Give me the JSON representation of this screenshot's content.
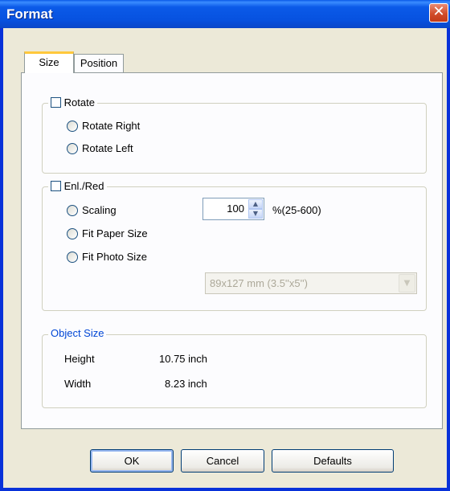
{
  "window": {
    "title": "Format",
    "close_glyph": "✕"
  },
  "tabs": [
    {
      "label": "Size",
      "active": true
    },
    {
      "label": "Position",
      "active": false
    }
  ],
  "rotate_group": {
    "label": "Rotate",
    "checked": false,
    "options": [
      {
        "label": "Rotate Right"
      },
      {
        "label": "Rotate Left"
      }
    ]
  },
  "enl_group": {
    "label": "Enl./Red",
    "checked": false,
    "options": [
      {
        "label": "Scaling"
      },
      {
        "label": "Fit Paper Size"
      },
      {
        "label": "Fit Photo Size"
      }
    ],
    "scaling_value": "100",
    "scaling_range": "%(25-600)",
    "photo_size": "89x127 mm (3.5''x5'')",
    "photo_size_enabled": false
  },
  "object_size": {
    "label": "Object Size",
    "height_label": "Height",
    "height_value": "10.75 inch",
    "width_label": "Width",
    "width_value": "8.23 inch"
  },
  "buttons": {
    "ok": "OK",
    "cancel": "Cancel",
    "defaults": "Defaults"
  },
  "icons": {
    "spin_up": "▲",
    "spin_down": "▼",
    "combo_arrow": "▼"
  }
}
